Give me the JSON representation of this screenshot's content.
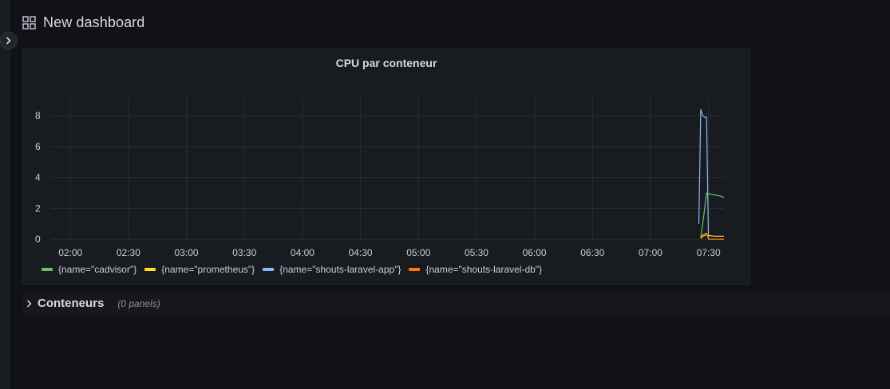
{
  "dashboard": {
    "title": "New dashboard"
  },
  "row": {
    "title": "Conteneurs",
    "panel_count": "(0 panels)"
  },
  "panel": {
    "title": "CPU par conteneur"
  },
  "colors": {
    "background": "#111217",
    "panel": "#181b1f",
    "grid": "#2b2d33",
    "text": "#ccccdc"
  },
  "legend": [
    {
      "label": "{name=\"cadvisor\"}",
      "color": "#73bf69"
    },
    {
      "label": "{name=\"prometheus\"}",
      "color": "#fade2a"
    },
    {
      "label": "{name=\"shouts-laravel-app\"}",
      "color": "#8ab8ff"
    },
    {
      "label": "{name=\"shouts-laravel-db\"}",
      "color": "#ff780a"
    }
  ],
  "chart_data": {
    "type": "line",
    "title": "CPU par conteneur",
    "x_ticks": [
      "02:00",
      "02:30",
      "03:00",
      "03:30",
      "04:00",
      "04:30",
      "05:00",
      "05:30",
      "06:00",
      "06:30",
      "07:00",
      "07:30"
    ],
    "y_ticks": [
      "0",
      "2",
      "4",
      "6",
      "8"
    ],
    "xlim": [
      "01:50",
      "07:38"
    ],
    "ylim": [
      -0.2,
      9.2
    ],
    "grid": true,
    "legend_position": "bottom",
    "series": [
      {
        "name": "{name=\"cadvisor\"}",
        "color": "#73bf69",
        "points": [
          [
            "07:26",
            0.1
          ],
          [
            "07:27",
            1.0
          ],
          [
            "07:28",
            2.0
          ],
          [
            "07:29",
            3.0
          ],
          [
            "07:30",
            2.95
          ],
          [
            "07:32",
            2.9
          ],
          [
            "07:34",
            2.85
          ],
          [
            "07:36",
            2.8
          ],
          [
            "07:38",
            2.7
          ]
        ]
      },
      {
        "name": "{name=\"prometheus\"}",
        "color": "#fade2a",
        "points": [
          [
            "07:26",
            0.05
          ],
          [
            "07:27",
            0.2
          ],
          [
            "07:28",
            0.25
          ],
          [
            "07:29",
            0.3
          ],
          [
            "07:30",
            0.25
          ],
          [
            "07:33",
            0.2
          ],
          [
            "07:38",
            0.2
          ]
        ]
      },
      {
        "name": "{name=\"shouts-laravel-app\"}",
        "color": "#8ab8ff",
        "points": [
          [
            "07:25",
            1.0
          ],
          [
            "07:26",
            8.4
          ],
          [
            "07:27",
            8.0
          ],
          [
            "07:28",
            7.9
          ],
          [
            "07:29",
            7.9
          ],
          [
            "07:30",
            0.0
          ]
        ]
      },
      {
        "name": "{name=\"shouts-laravel-db\"}",
        "color": "#ff780a",
        "points": [
          [
            "07:26",
            0.1
          ],
          [
            "07:27",
            0.3
          ],
          [
            "07:28",
            0.35
          ],
          [
            "07:29",
            0.4
          ],
          [
            "07:30",
            0.0
          ],
          [
            "07:38",
            0.0
          ]
        ]
      }
    ]
  }
}
